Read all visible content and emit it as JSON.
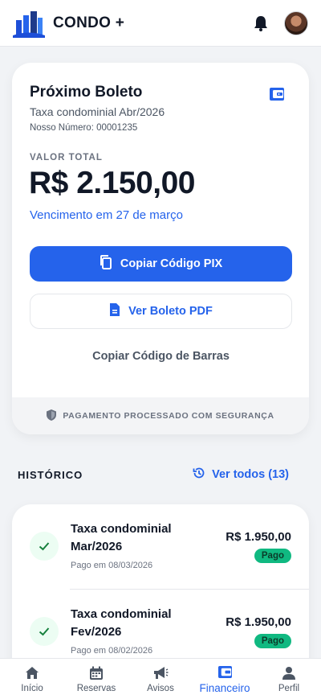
{
  "header": {
    "brand": "CONDO +"
  },
  "boleto": {
    "title": "Próximo Boleto",
    "subtitle": "Taxa condominial Abr/2026",
    "reference": "Nosso Número: 00001235",
    "total_label": "VALOR TOTAL",
    "total_value": "R$ 2.150,00",
    "due": "Vencimento em 27 de março",
    "pix_button": "Copiar Código PIX",
    "pdf_button": "Ver Boleto PDF",
    "barcode_button": "Copiar Código de Barras",
    "secure_note": "PAGAMENTO PROCESSADO COM SEGURANÇA"
  },
  "history": {
    "title": "HISTÓRICO",
    "view_all": "Ver todos (13)",
    "items": [
      {
        "title": "Taxa condominial Mar/2026",
        "date": "Pago em 08/03/2026",
        "amount": "R$ 1.950,00",
        "status": "Pago"
      },
      {
        "title": "Taxa condominial Fev/2026",
        "date": "Pago em 08/02/2026",
        "amount": "R$ 1.950,00",
        "status": "Pago"
      }
    ]
  },
  "nav": {
    "items": [
      {
        "label": "Início",
        "icon": "home-icon"
      },
      {
        "label": "Reservas",
        "icon": "calendar-icon"
      },
      {
        "label": "Avisos",
        "icon": "megaphone-icon"
      },
      {
        "label": "Financeiro",
        "icon": "wallet-icon",
        "active": true
      },
      {
        "label": "Perfil",
        "icon": "user-icon"
      }
    ]
  },
  "colors": {
    "primary": "#2563eb",
    "success": "#10b981",
    "background": "#f1f3f6"
  }
}
